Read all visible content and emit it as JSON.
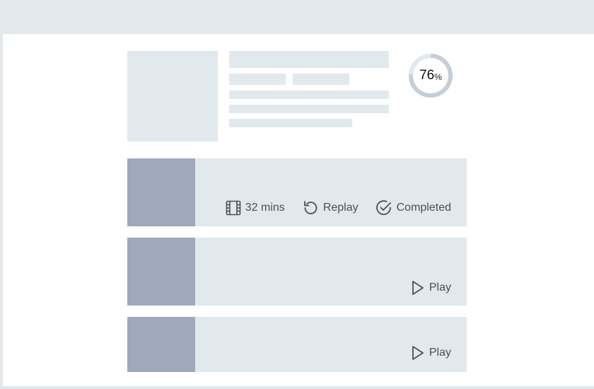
{
  "progress": {
    "value": "76",
    "unit": "%",
    "fraction": 0.76,
    "track_color": "#c5cdd9",
    "fill_color": "#e2e9ec"
  },
  "rows": [
    {
      "actions": [
        {
          "icon": "film-icon",
          "label": "32 mins"
        },
        {
          "icon": "replay-icon",
          "label": "Replay"
        },
        {
          "icon": "check-circle-icon",
          "label": "Completed"
        }
      ]
    },
    {
      "actions": [
        {
          "icon": "play-icon",
          "label": "Play"
        }
      ]
    },
    {
      "actions": [
        {
          "icon": "play-icon",
          "label": "Play"
        }
      ]
    }
  ],
  "colors": {
    "background": "#e2e9ec",
    "card": "#ffffff",
    "thumbnail": "#9ea9bc",
    "text": "#4a4f55"
  }
}
